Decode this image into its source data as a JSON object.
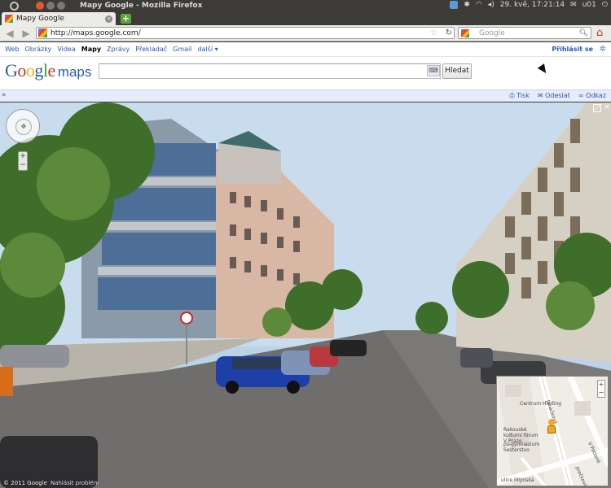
{
  "os_panel": {
    "window_title": "Mapy Google - Mozilla Firefox",
    "datetime": "29. kvě, 17:21:14",
    "user": "u01"
  },
  "browser": {
    "tab_title": "Mapy Google",
    "url": "http://maps.google.com/",
    "search_placeholder": "Google"
  },
  "gbar": {
    "links": [
      "Web",
      "Obrázky",
      "Videa",
      "Mapy",
      "Zprávy",
      "Překladač",
      "Gmail",
      "další ▾"
    ],
    "signin": "Přihlásit se"
  },
  "header": {
    "logo_word": "Google",
    "logo_maps": "maps",
    "search_value": "",
    "search_button": "Hledat"
  },
  "toolbar": {
    "collapse": "»",
    "print": "Tisk",
    "send": "Odeslat",
    "link": "Odkaz"
  },
  "streetview": {
    "copyright": "© 2011 Google",
    "report_link": "Nahlásit problém"
  },
  "minimap": {
    "labels": [
      "Centrum Holding",
      "Rakouské kulturní fórum V Praze",
      "ps-gymnázium Sesterstvo",
      "Janáčkova",
      "V Pátlaně",
      "Jirečkova",
      "ulice Mlýnská"
    ]
  }
}
